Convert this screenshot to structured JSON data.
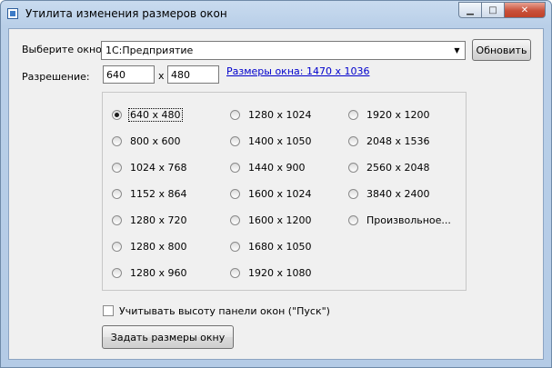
{
  "window": {
    "title": "Утилита изменения размеров окон"
  },
  "form": {
    "window_label": "Выберите окно:",
    "window_value": "1С:Предприятие",
    "refresh_label": "Обновить",
    "resolution_label": "Разрешение:",
    "width_value": "640",
    "x_sep": "x",
    "height_value": "480",
    "window_size_link": "Размеры окна: 1470 x 1036"
  },
  "resolutions": {
    "col1": [
      "640 x 480",
      "800 x 600",
      "1024 x 768",
      "1152 x 864",
      "1280 x 720",
      "1280 x 800",
      "1280 x 960"
    ],
    "col2": [
      "1280 x 1024",
      "1400 x 1050",
      "1440 x 900",
      "1600 x 1024",
      "1600 x 1200",
      "1680 x 1050",
      "1920 x 1080"
    ],
    "col3": [
      "1920 x 1200",
      "2048 x 1536",
      "2560 x 2048",
      "3840 x 2400",
      "Произвольное..."
    ],
    "selected": "640 x 480"
  },
  "taskbar_checkbox": {
    "label": "Учитывать высоту панели окон (\"Пуск\")",
    "checked": false
  },
  "apply_button": "Задать размеры окну"
}
